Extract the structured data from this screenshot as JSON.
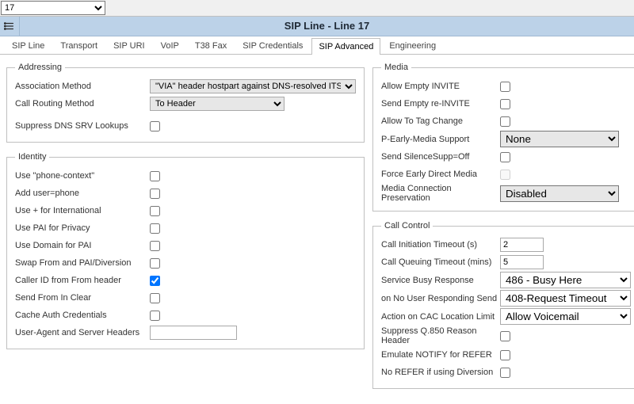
{
  "top_select_value": "17",
  "title": "SIP Line - Line 17",
  "tabs": [
    "SIP Line",
    "Transport",
    "SIP URI",
    "VoIP",
    "T38 Fax",
    "SIP Credentials",
    "SIP Advanced",
    "Engineering"
  ],
  "active_tab": "SIP Advanced",
  "left": {
    "addressing": {
      "legend": "Addressing",
      "association_label": "Association Method",
      "association_value": "\"VIA\" header hostpart against DNS-resolved ITSP domain",
      "call_routing_label": "Call Routing Method",
      "call_routing_value": "To Header",
      "suppress_dns_label": "Suppress DNS SRV Lookups",
      "suppress_dns_checked": false
    },
    "identity": {
      "legend": "Identity",
      "items": [
        {
          "label": "Use \"phone-context\"",
          "checked": false
        },
        {
          "label": "Add user=phone",
          "checked": false
        },
        {
          "label": "Use + for International",
          "checked": false
        },
        {
          "label": "Use PAI for Privacy",
          "checked": false
        },
        {
          "label": "Use Domain for PAI",
          "checked": false
        },
        {
          "label": "Swap From and PAI/Diversion",
          "checked": false
        },
        {
          "label": "Caller ID from From header",
          "checked": true
        },
        {
          "label": "Send From In Clear",
          "checked": false
        },
        {
          "label": "Cache Auth Credentials",
          "checked": false
        }
      ],
      "ua_label": "User-Agent and Server Headers",
      "ua_value": ""
    }
  },
  "right": {
    "media": {
      "legend": "Media",
      "allow_empty_invite": {
        "label": "Allow Empty INVITE",
        "checked": false
      },
      "send_empty_reinvite": {
        "label": "Send Empty re-INVITE",
        "checked": false
      },
      "allow_to_tag_change": {
        "label": "Allow To Tag Change",
        "checked": false
      },
      "p_early_media": {
        "label": "P-Early-Media Support",
        "value": "None"
      },
      "send_silence_supp_off": {
        "label": "Send SilenceSupp=Off",
        "checked": false
      },
      "force_early_direct": {
        "label": "Force Early Direct Media",
        "checked": false,
        "disabled": true
      },
      "media_conn_preserv": {
        "label": "Media Connection Preservation",
        "value": "Disabled"
      }
    },
    "cc": {
      "legend": "Call Control",
      "init_timeout": {
        "label": "Call Initiation Timeout (s)",
        "value": "2"
      },
      "queuing_timeout": {
        "label": "Call Queuing Timeout (mins)",
        "value": "5"
      },
      "service_busy": {
        "label": "Service Busy Response",
        "value": "486 - Busy Here"
      },
      "no_user_resp": {
        "label": "on No User Responding Send",
        "value": "408-Request Timeout"
      },
      "cac_limit": {
        "label": "Action on CAC Location Limit",
        "value": "Allow Voicemail"
      },
      "suppress_q850": {
        "label": "Suppress Q.850 Reason Header",
        "checked": false
      },
      "emulate_notify_refer": {
        "label": "Emulate NOTIFY for REFER",
        "checked": false
      },
      "no_refer_diversion": {
        "label": "No REFER if using Diversion",
        "checked": false
      }
    }
  }
}
